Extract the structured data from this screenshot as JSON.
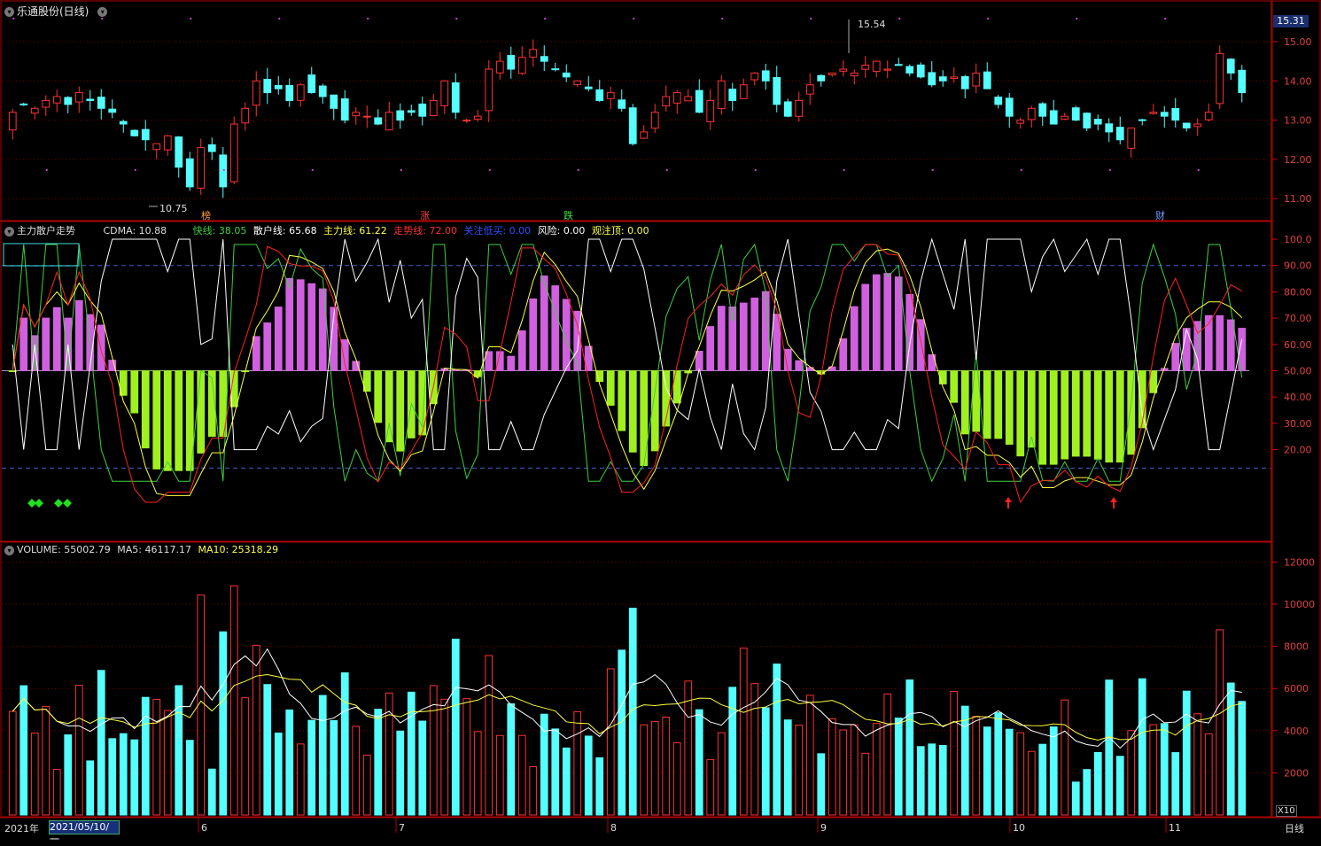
{
  "window": {
    "title": "乐通股份(日线)",
    "current_price": "15.31",
    "period_label": "日线",
    "scale_label": "X10"
  },
  "price_panel": {
    "y_ticks": [
      "15.00",
      "14.00",
      "13.00",
      "12.00",
      "11.00"
    ],
    "high_label": "15.54",
    "low_label": "10.75",
    "markers": [
      {
        "text": "榜",
        "color": "#ff9b3b"
      },
      {
        "text": "涨",
        "color": "#ff4040"
      },
      {
        "text": "跌",
        "color": "#3fe03f"
      },
      {
        "text": "财",
        "color": "#6ea0ff"
      }
    ]
  },
  "indicator_panel": {
    "name": "主力散户走势",
    "cdma": "CDMA: 10.88",
    "fast": "快线: 38.05",
    "retail": "散户线: 65.68",
    "main": "主力线: 61.22",
    "trend": "走势线: 72.00",
    "focus": "关注低买: 0.00",
    "risk": "风险: 0.00",
    "watch_top": "观注顶: 0.00",
    "y_ticks": [
      "100.0",
      "90.00",
      "80.00",
      "70.00",
      "60.00",
      "50.00",
      "40.00",
      "30.00",
      "20.00"
    ]
  },
  "volume_panel": {
    "volume": "VOLUME: 55002.79",
    "ma5": "MA5: 46117.17",
    "ma10": "MA10: 25318.29",
    "y_ticks": [
      "12000",
      "10000",
      "8000",
      "6000",
      "4000",
      "2000"
    ]
  },
  "time_axis": {
    "year": "2021年",
    "cursor_date": "2021/05/10/一",
    "months": [
      "6",
      "7",
      "8",
      "9",
      "10",
      "11"
    ]
  },
  "colors": {
    "up": "#ff3232",
    "down": "#54ffff",
    "fast": "#3fd03f",
    "retail": "#ffffff",
    "main": "#ffff40",
    "trend": "#ff2020",
    "pos_hist": "#d060e0",
    "neg_hist": "#a0f020"
  },
  "chart_data": {
    "type": "candlestick",
    "closes": [
      13.2,
      13.4,
      13.3,
      13.5,
      13.6,
      13.4,
      13.7,
      13.5,
      13.3,
      13.2,
      12.9,
      12.6,
      12.5,
      12.4,
      12.6,
      11.8,
      11.3,
      12.3,
      12.2,
      11.3,
      12.9,
      13.3,
      14.0,
      13.7,
      13.8,
      13.5,
      13.9,
      13.7,
      13.6,
      13.3,
      13.0,
      13.2,
      13.1,
      12.9,
      13.2,
      13.0,
      13.2,
      13.1,
      13.5,
      14.0,
      13.2,
      13.0,
      13.1,
      14.3,
      14.5,
      14.3,
      14.6,
      14.8,
      14.5,
      14.3,
      14.1,
      14.0,
      13.8,
      13.5,
      13.7,
      13.3,
      12.4,
      12.7,
      13.2,
      13.6,
      13.7,
      13.6,
      13.2,
      13.5,
      14.0,
      13.5,
      13.9,
      14.2,
      14.0,
      13.4,
      13.1,
      13.5,
      13.9,
      14.0,
      14.2,
      14.3,
      14.2,
      14.4,
      14.5,
      14.3,
      14.4,
      14.2,
      14.1,
      13.9,
      14.0,
      14.1,
      13.8,
      14.2,
      13.8,
      13.4,
      13.1,
      13.0,
      13.3,
      13.1,
      12.9,
      13.1,
      13.0,
      12.8,
      12.9,
      12.7,
      12.5,
      12.8,
      13.0,
      13.2,
      13.1,
      13.0,
      12.8,
      12.9,
      13.2,
      14.7,
      14.2,
      13.7
    ]
  }
}
